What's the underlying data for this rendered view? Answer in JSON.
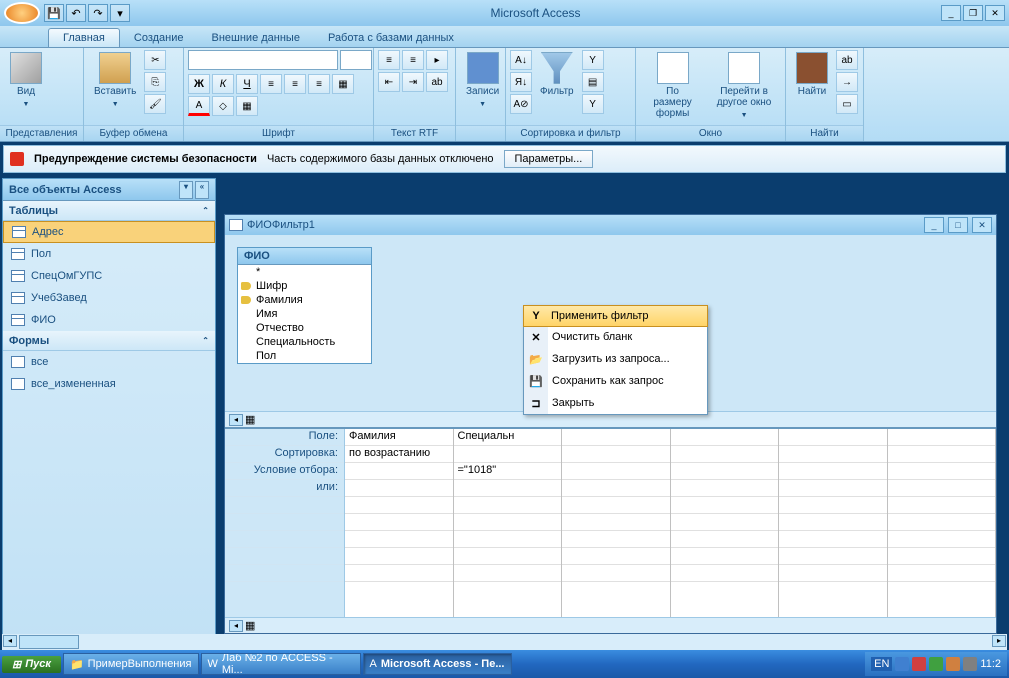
{
  "app_title": "Microsoft Access",
  "tabs": [
    "Главная",
    "Создание",
    "Внешние данные",
    "Работа с базами данных"
  ],
  "active_tab": 0,
  "ribbon_groups": {
    "views": {
      "label": "Представления",
      "btn": "Вид"
    },
    "clipboard": {
      "label": "Буфер обмена",
      "btn": "Вставить"
    },
    "font": {
      "label": "Шрифт"
    },
    "rtf": {
      "label": "Текст RTF"
    },
    "records": {
      "label": "",
      "btn": "Записи"
    },
    "sortfilter": {
      "label": "Сортировка и фильтр",
      "btn": "Фильтр"
    },
    "window": {
      "label": "Окно",
      "btn1": "По размеру формы",
      "btn2": "Перейти в другое окно"
    },
    "find": {
      "label": "Найти",
      "btn": "Найти"
    }
  },
  "security": {
    "title": "Предупреждение системы безопасности",
    "msg": "Часть содержимого базы данных отключено",
    "btn": "Параметры..."
  },
  "nav": {
    "title": "Все объекты Access",
    "cat_tables": "Таблицы",
    "tables": [
      "Адрес",
      "Пол",
      "СпецОмГУПС",
      "УчебЗавед",
      "ФИО"
    ],
    "cat_forms": "Формы",
    "forms": [
      "все",
      "все_измененная"
    ]
  },
  "subwin": {
    "title": "ФИОФильтр1",
    "fieldlist_title": "ФИО",
    "fields": [
      "*",
      "Шифр",
      "Фамилия",
      "Имя",
      "Отчество",
      "Специальность",
      "Пол"
    ],
    "grid_labels": [
      "Поле:",
      "Сортировка:",
      "Условие отбора:",
      "или:"
    ],
    "col1": {
      "field": "Фамилия",
      "sort": "по возрастанию",
      "cond": ""
    },
    "col2": {
      "field": "Специальн",
      "sort": "",
      "cond": "=\"1018\""
    }
  },
  "context_menu": [
    "Применить фильтр",
    "Очистить бланк",
    "Загрузить из запроса...",
    "Сохранить как запрос",
    "Закрыть"
  ],
  "taskbar": {
    "start": "Пуск",
    "items": [
      "ПримерВыполнения",
      "Лаб №2 по ACCESS - Mi...",
      "Microsoft Access - Пе..."
    ],
    "lang": "EN",
    "clock": "11:2"
  }
}
